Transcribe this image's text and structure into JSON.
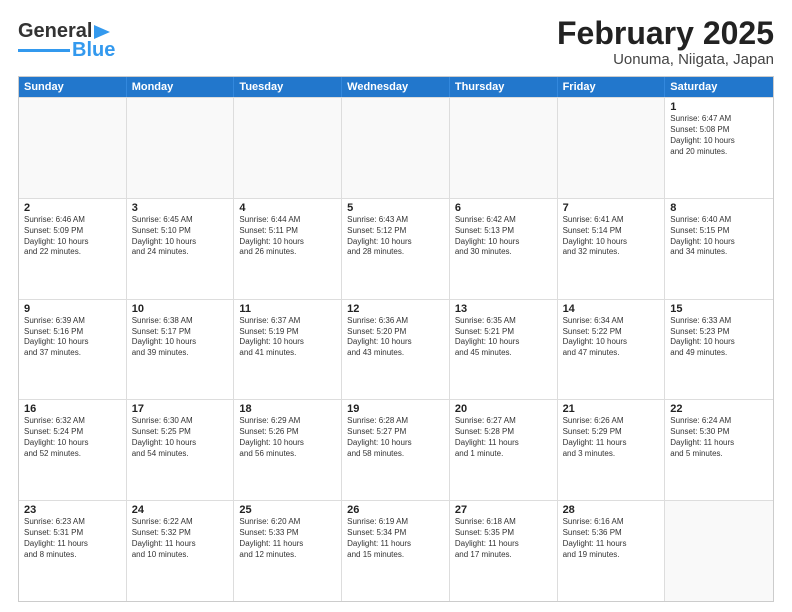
{
  "logo": {
    "line1": "General",
    "line2": "Blue"
  },
  "title": "February 2025",
  "subtitle": "Uonuma, Niigata, Japan",
  "days": [
    "Sunday",
    "Monday",
    "Tuesday",
    "Wednesday",
    "Thursday",
    "Friday",
    "Saturday"
  ],
  "rows": [
    [
      {
        "day": "",
        "info": ""
      },
      {
        "day": "",
        "info": ""
      },
      {
        "day": "",
        "info": ""
      },
      {
        "day": "",
        "info": ""
      },
      {
        "day": "",
        "info": ""
      },
      {
        "day": "",
        "info": ""
      },
      {
        "day": "1",
        "info": "Sunrise: 6:47 AM\nSunset: 5:08 PM\nDaylight: 10 hours\nand 20 minutes."
      }
    ],
    [
      {
        "day": "2",
        "info": "Sunrise: 6:46 AM\nSunset: 5:09 PM\nDaylight: 10 hours\nand 22 minutes."
      },
      {
        "day": "3",
        "info": "Sunrise: 6:45 AM\nSunset: 5:10 PM\nDaylight: 10 hours\nand 24 minutes."
      },
      {
        "day": "4",
        "info": "Sunrise: 6:44 AM\nSunset: 5:11 PM\nDaylight: 10 hours\nand 26 minutes."
      },
      {
        "day": "5",
        "info": "Sunrise: 6:43 AM\nSunset: 5:12 PM\nDaylight: 10 hours\nand 28 minutes."
      },
      {
        "day": "6",
        "info": "Sunrise: 6:42 AM\nSunset: 5:13 PM\nDaylight: 10 hours\nand 30 minutes."
      },
      {
        "day": "7",
        "info": "Sunrise: 6:41 AM\nSunset: 5:14 PM\nDaylight: 10 hours\nand 32 minutes."
      },
      {
        "day": "8",
        "info": "Sunrise: 6:40 AM\nSunset: 5:15 PM\nDaylight: 10 hours\nand 34 minutes."
      }
    ],
    [
      {
        "day": "9",
        "info": "Sunrise: 6:39 AM\nSunset: 5:16 PM\nDaylight: 10 hours\nand 37 minutes."
      },
      {
        "day": "10",
        "info": "Sunrise: 6:38 AM\nSunset: 5:17 PM\nDaylight: 10 hours\nand 39 minutes."
      },
      {
        "day": "11",
        "info": "Sunrise: 6:37 AM\nSunset: 5:19 PM\nDaylight: 10 hours\nand 41 minutes."
      },
      {
        "day": "12",
        "info": "Sunrise: 6:36 AM\nSunset: 5:20 PM\nDaylight: 10 hours\nand 43 minutes."
      },
      {
        "day": "13",
        "info": "Sunrise: 6:35 AM\nSunset: 5:21 PM\nDaylight: 10 hours\nand 45 minutes."
      },
      {
        "day": "14",
        "info": "Sunrise: 6:34 AM\nSunset: 5:22 PM\nDaylight: 10 hours\nand 47 minutes."
      },
      {
        "day": "15",
        "info": "Sunrise: 6:33 AM\nSunset: 5:23 PM\nDaylight: 10 hours\nand 49 minutes."
      }
    ],
    [
      {
        "day": "16",
        "info": "Sunrise: 6:32 AM\nSunset: 5:24 PM\nDaylight: 10 hours\nand 52 minutes."
      },
      {
        "day": "17",
        "info": "Sunrise: 6:30 AM\nSunset: 5:25 PM\nDaylight: 10 hours\nand 54 minutes."
      },
      {
        "day": "18",
        "info": "Sunrise: 6:29 AM\nSunset: 5:26 PM\nDaylight: 10 hours\nand 56 minutes."
      },
      {
        "day": "19",
        "info": "Sunrise: 6:28 AM\nSunset: 5:27 PM\nDaylight: 10 hours\nand 58 minutes."
      },
      {
        "day": "20",
        "info": "Sunrise: 6:27 AM\nSunset: 5:28 PM\nDaylight: 11 hours\nand 1 minute."
      },
      {
        "day": "21",
        "info": "Sunrise: 6:26 AM\nSunset: 5:29 PM\nDaylight: 11 hours\nand 3 minutes."
      },
      {
        "day": "22",
        "info": "Sunrise: 6:24 AM\nSunset: 5:30 PM\nDaylight: 11 hours\nand 5 minutes."
      }
    ],
    [
      {
        "day": "23",
        "info": "Sunrise: 6:23 AM\nSunset: 5:31 PM\nDaylight: 11 hours\nand 8 minutes."
      },
      {
        "day": "24",
        "info": "Sunrise: 6:22 AM\nSunset: 5:32 PM\nDaylight: 11 hours\nand 10 minutes."
      },
      {
        "day": "25",
        "info": "Sunrise: 6:20 AM\nSunset: 5:33 PM\nDaylight: 11 hours\nand 12 minutes."
      },
      {
        "day": "26",
        "info": "Sunrise: 6:19 AM\nSunset: 5:34 PM\nDaylight: 11 hours\nand 15 minutes."
      },
      {
        "day": "27",
        "info": "Sunrise: 6:18 AM\nSunset: 5:35 PM\nDaylight: 11 hours\nand 17 minutes."
      },
      {
        "day": "28",
        "info": "Sunrise: 6:16 AM\nSunset: 5:36 PM\nDaylight: 11 hours\nand 19 minutes."
      },
      {
        "day": "",
        "info": ""
      }
    ]
  ]
}
